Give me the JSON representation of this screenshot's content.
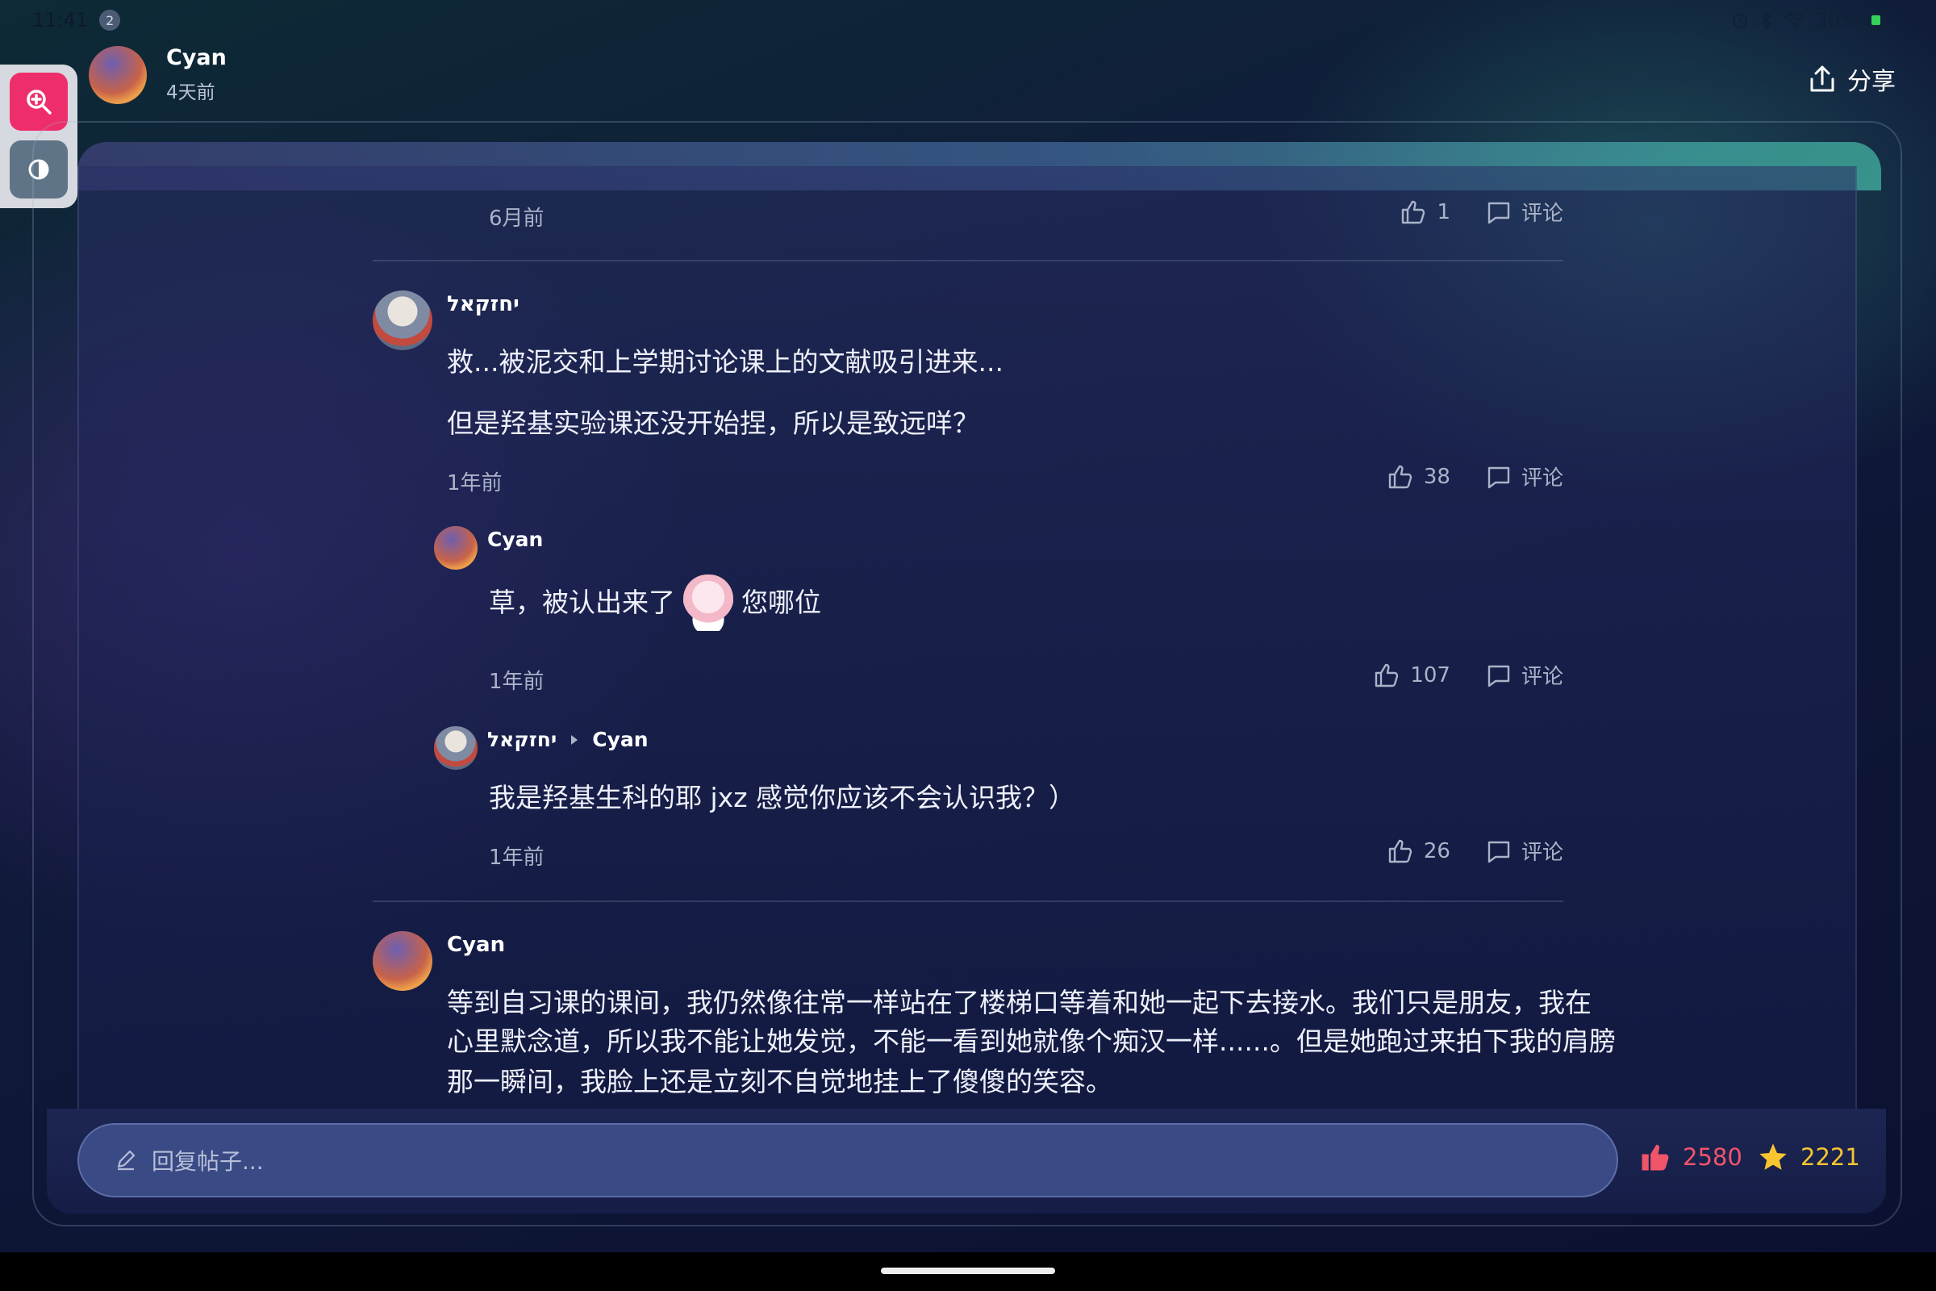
{
  "status_bar": {
    "time": "11:41",
    "notifications": "2",
    "battery": "30%",
    "battery_level": 0.3
  },
  "header": {
    "author": "Cyan",
    "posted": "4天前",
    "share_label": "分享"
  },
  "floating_tools": {
    "zoom": "zoom-in-icon",
    "contrast": "contrast-icon"
  },
  "comments": {
    "top_partial": {
      "time": "6月前",
      "likes": "1",
      "comment_label": "评论"
    },
    "c1": {
      "user": "יחזקאל",
      "lines": [
        "救...被泥交和上学期讨论课上的文献吸引进来...",
        "但是羟基实验课还没开始捏，所以是致远咩？"
      ],
      "time": "1年前",
      "likes": "38",
      "comment_label": "评论",
      "replies": [
        {
          "user": "Cyan",
          "text_before": "草，被认出来了",
          "text_after": "您哪位",
          "time": "1年前",
          "likes": "107",
          "comment_label": "评论"
        },
        {
          "user": "יחזקאל",
          "reply_to": "Cyan",
          "text": "我是羟基生科的耶 jxz 感觉你应该不会认识我？）",
          "time": "1年前",
          "likes": "26",
          "comment_label": "评论"
        }
      ]
    },
    "c2": {
      "user": "Cyan",
      "lines": [
        "等到自习课的课间，我仍然像往常一样站在了楼梯口等着和她一起下去接水。我们只是朋友，我在",
        "心里默念道，所以我不能让她发觉，不能一看到她就像个痴汉一样......。但是她跑过来拍下我的肩膀",
        "那一瞬间，我脸上还是立刻不自觉地挂上了傻傻的笑容。"
      ]
    }
  },
  "bottom": {
    "reply_placeholder": "回复帖子...",
    "likes": "2580",
    "stars": "2221"
  },
  "colors": {
    "like_red": "#f0556a",
    "star_yellow": "#f7c531",
    "accent_pink": "#ee2e6a"
  }
}
